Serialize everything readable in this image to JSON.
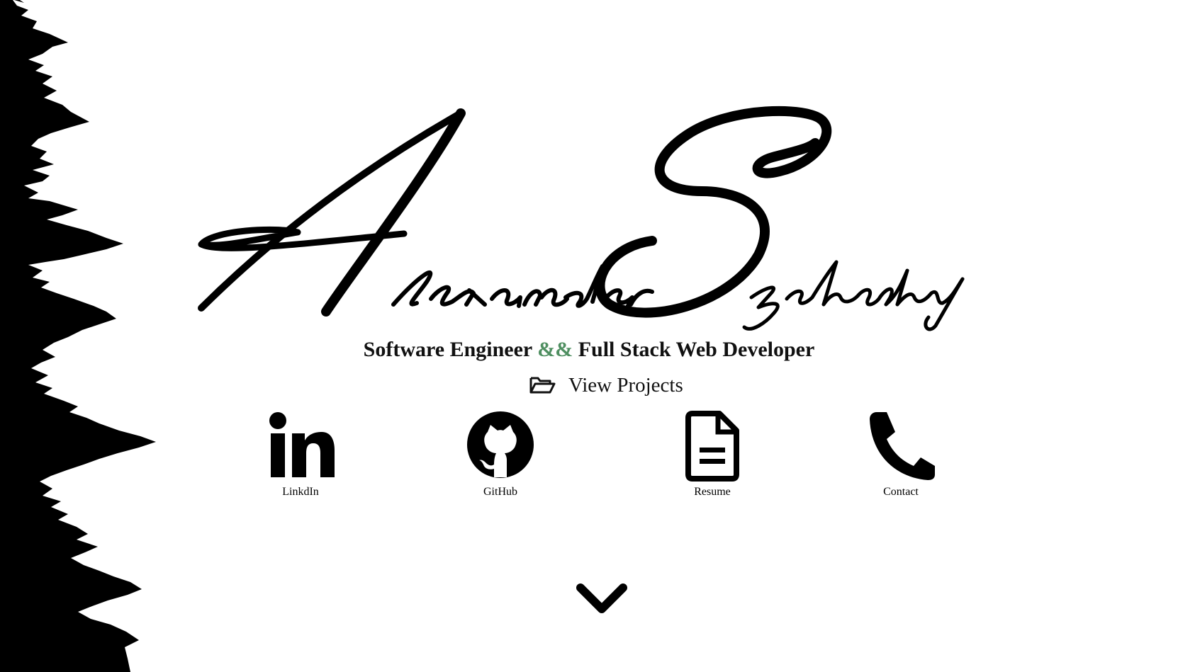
{
  "hero": {
    "signature_name": "Alexander Szelestey",
    "subtitle_part1": "Software Engineer",
    "subtitle_separator": "&&",
    "subtitle_part2": "Full Stack Web Developer"
  },
  "actions": {
    "view_projects_label": "View Projects"
  },
  "social": [
    {
      "label": "LinkdIn",
      "icon": "linkedin-icon"
    },
    {
      "label": "GitHub",
      "icon": "github-icon"
    },
    {
      "label": "Resume",
      "icon": "document-icon"
    },
    {
      "label": "Contact",
      "icon": "phone-icon"
    }
  ],
  "colors": {
    "accent": "#4f8f61",
    "ink": "#000000",
    "background": "#ffffff"
  }
}
